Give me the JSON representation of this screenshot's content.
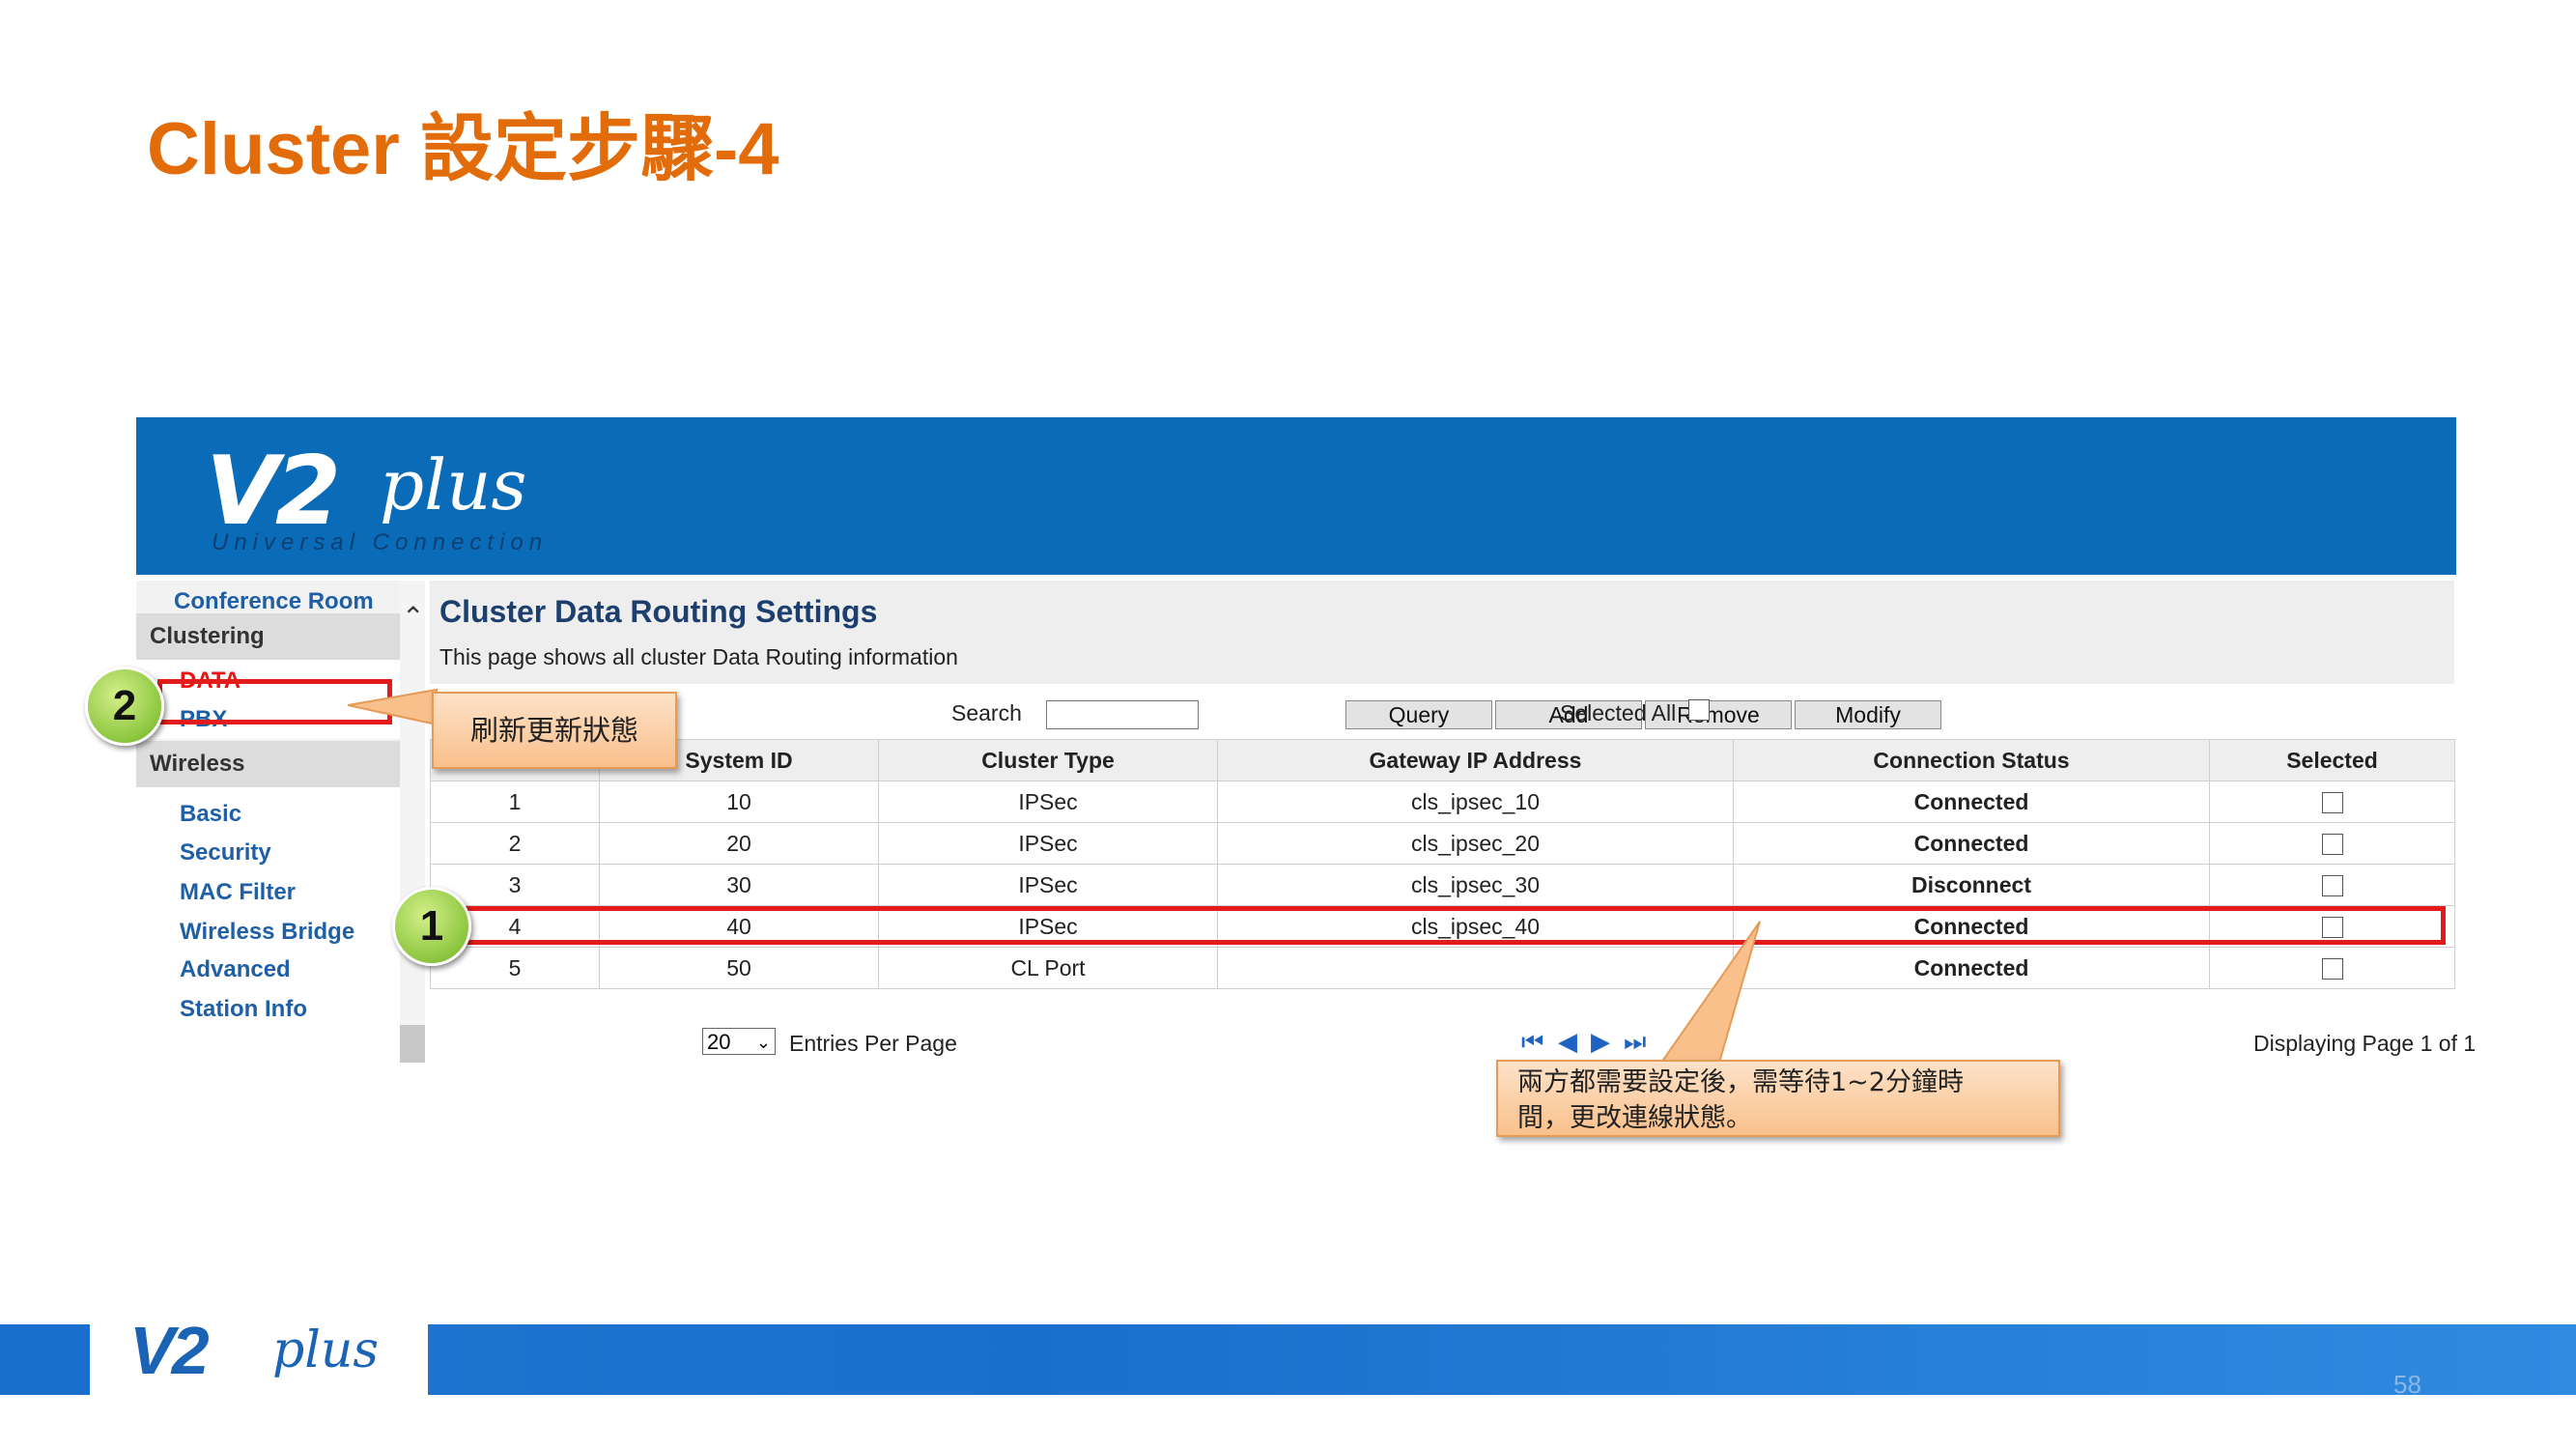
{
  "slide": {
    "title": "Cluster 設定步驟-4",
    "page_number": "58"
  },
  "brand": {
    "logo_main": "V2",
    "logo_script": "plus",
    "tagline": "Universal Connection"
  },
  "sidebar": {
    "conference_room": "Conference Room",
    "clustering_header": "Clustering",
    "clustering_items": [
      {
        "label": "DATA",
        "active": true
      },
      {
        "label": "PBX",
        "active": false
      }
    ],
    "wireless_header": "Wireless",
    "wireless_items": [
      {
        "label": "Basic"
      },
      {
        "label": "Security"
      },
      {
        "label": "MAC Filter"
      },
      {
        "label": "Wireless Bridge"
      },
      {
        "label": "Advanced"
      },
      {
        "label": "Station Info"
      }
    ]
  },
  "main": {
    "heading": "Cluster Data Routing Settings",
    "description": "This page shows all cluster Data Routing information",
    "search_label": "Search",
    "search_value": "",
    "buttons": {
      "query": "Query",
      "add": "Add",
      "remove": "Remove",
      "modify": "Modify"
    },
    "selected_all_label": "Selected All",
    "table": {
      "columns": [
        "",
        "System ID",
        "Cluster Type",
        "Gateway IP Address",
        "Connection Status",
        "Selected"
      ],
      "rows": [
        {
          "index": "1",
          "system_id": "10",
          "type": "IPSec",
          "gateway": "cls_ipsec_10",
          "status": "Connected"
        },
        {
          "index": "2",
          "system_id": "20",
          "type": "IPSec",
          "gateway": "cls_ipsec_20",
          "status": "Connected"
        },
        {
          "index": "3",
          "system_id": "30",
          "type": "IPSec",
          "gateway": "cls_ipsec_30",
          "status": "Disconnect"
        },
        {
          "index": "4",
          "system_id": "40",
          "type": "IPSec",
          "gateway": "cls_ipsec_40",
          "status": "Connected"
        },
        {
          "index": "5",
          "system_id": "50",
          "type": "CL Port",
          "gateway": "",
          "status": "Connected"
        }
      ]
    },
    "per_page_value": "20",
    "per_page_label": "Entries Per Page",
    "page_status": "Displaying Page 1 of 1"
  },
  "annotations": {
    "badge_1": "1",
    "badge_2": "2",
    "callout_refresh": "刷新更新狀態",
    "callout_wait_line1": "兩方都需要設定後，需等待1~2分鐘時",
    "callout_wait_line2": "間，更改連線狀態。"
  },
  "colors": {
    "title": "#E36C0A",
    "banner": "#0A6CB8",
    "connected": "#13a538",
    "disconnect": "#e11111",
    "highlight": "#e41b1b"
  }
}
